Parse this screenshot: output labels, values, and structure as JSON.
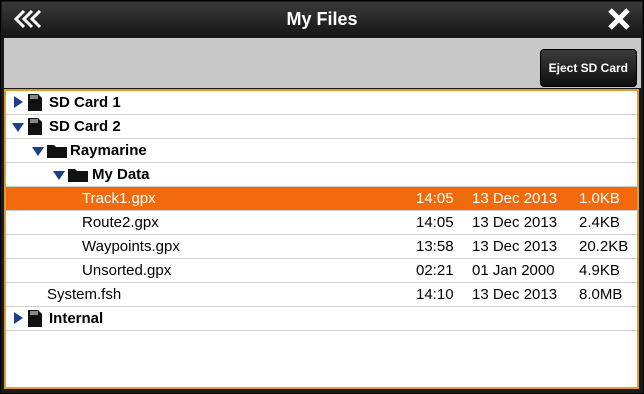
{
  "window": {
    "title": "My Files"
  },
  "toolbar": {
    "eject_label": "Eject SD Card"
  },
  "tree": {
    "sd_card_1": "SD Card 1",
    "sd_card_2": "SD Card 2",
    "raymarine": "Raymarine",
    "my_data": "My Data",
    "internal": "Internal"
  },
  "files": [
    {
      "name": "Track1.gpx",
      "time": "14:05",
      "date": "13 Dec 2013",
      "size": "1.0KB"
    },
    {
      "name": "Route2.gpx",
      "time": "14:05",
      "date": "13 Dec 2013",
      "size": "2.4KB"
    },
    {
      "name": "Waypoints.gpx",
      "time": "13:58",
      "date": "13 Dec 2013",
      "size": "20.2KB"
    },
    {
      "name": "Unsorted.gpx",
      "time": "02:21",
      "date": "01 Jan 2000",
      "size": "4.9KB"
    },
    {
      "name": "System.fsh",
      "time": "14:10",
      "date": "13 Dec 2013",
      "size": "8.0MB"
    }
  ],
  "colors": {
    "selected": "#f26a0c",
    "accent_border": "#e39a2e",
    "expander": "#1c3e8a"
  }
}
